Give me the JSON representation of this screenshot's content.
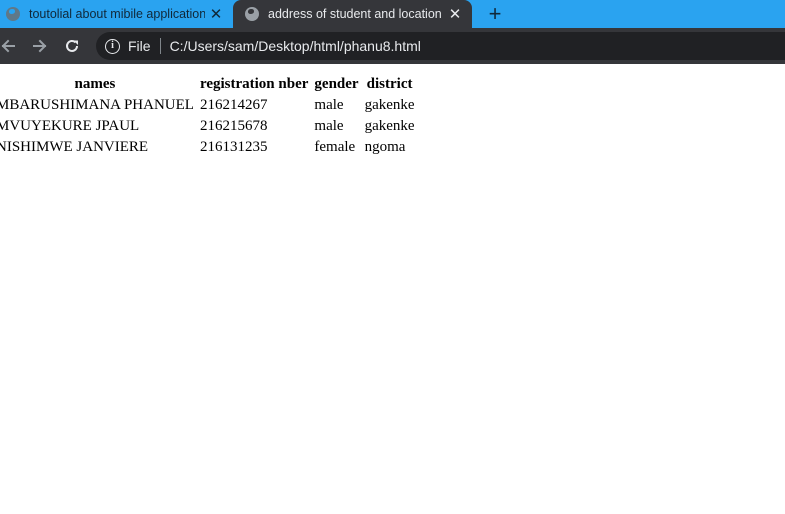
{
  "tabs": [
    {
      "title": "toutolial about mibile application",
      "active": false,
      "favicon": "globe-icon",
      "close": "✕"
    },
    {
      "title": "address of student and location",
      "active": true,
      "favicon": "globe-icon",
      "close": "✕"
    }
  ],
  "new_tab": "+",
  "toolbar": {
    "security_chip": "File",
    "url": "C:/Users/sam/Desktop/html/phanu8.html"
  },
  "table": {
    "headers": [
      "names",
      "registration nber",
      "gender",
      "district"
    ],
    "rows": [
      [
        "MBARUSHIMANA PHANUEL",
        "216214267",
        "male",
        "gakenke"
      ],
      [
        "MVUYEKURE JPAUL",
        "216215678",
        "male",
        "gakenke"
      ],
      [
        "NISHIMWE JANVIERE",
        "216131235",
        "female",
        "ngoma"
      ]
    ]
  },
  "colors": {
    "tabstrip": "#2aa3f0",
    "active_tab": "#35363a",
    "omnibox": "#202124",
    "page_background": "#ffffff"
  }
}
